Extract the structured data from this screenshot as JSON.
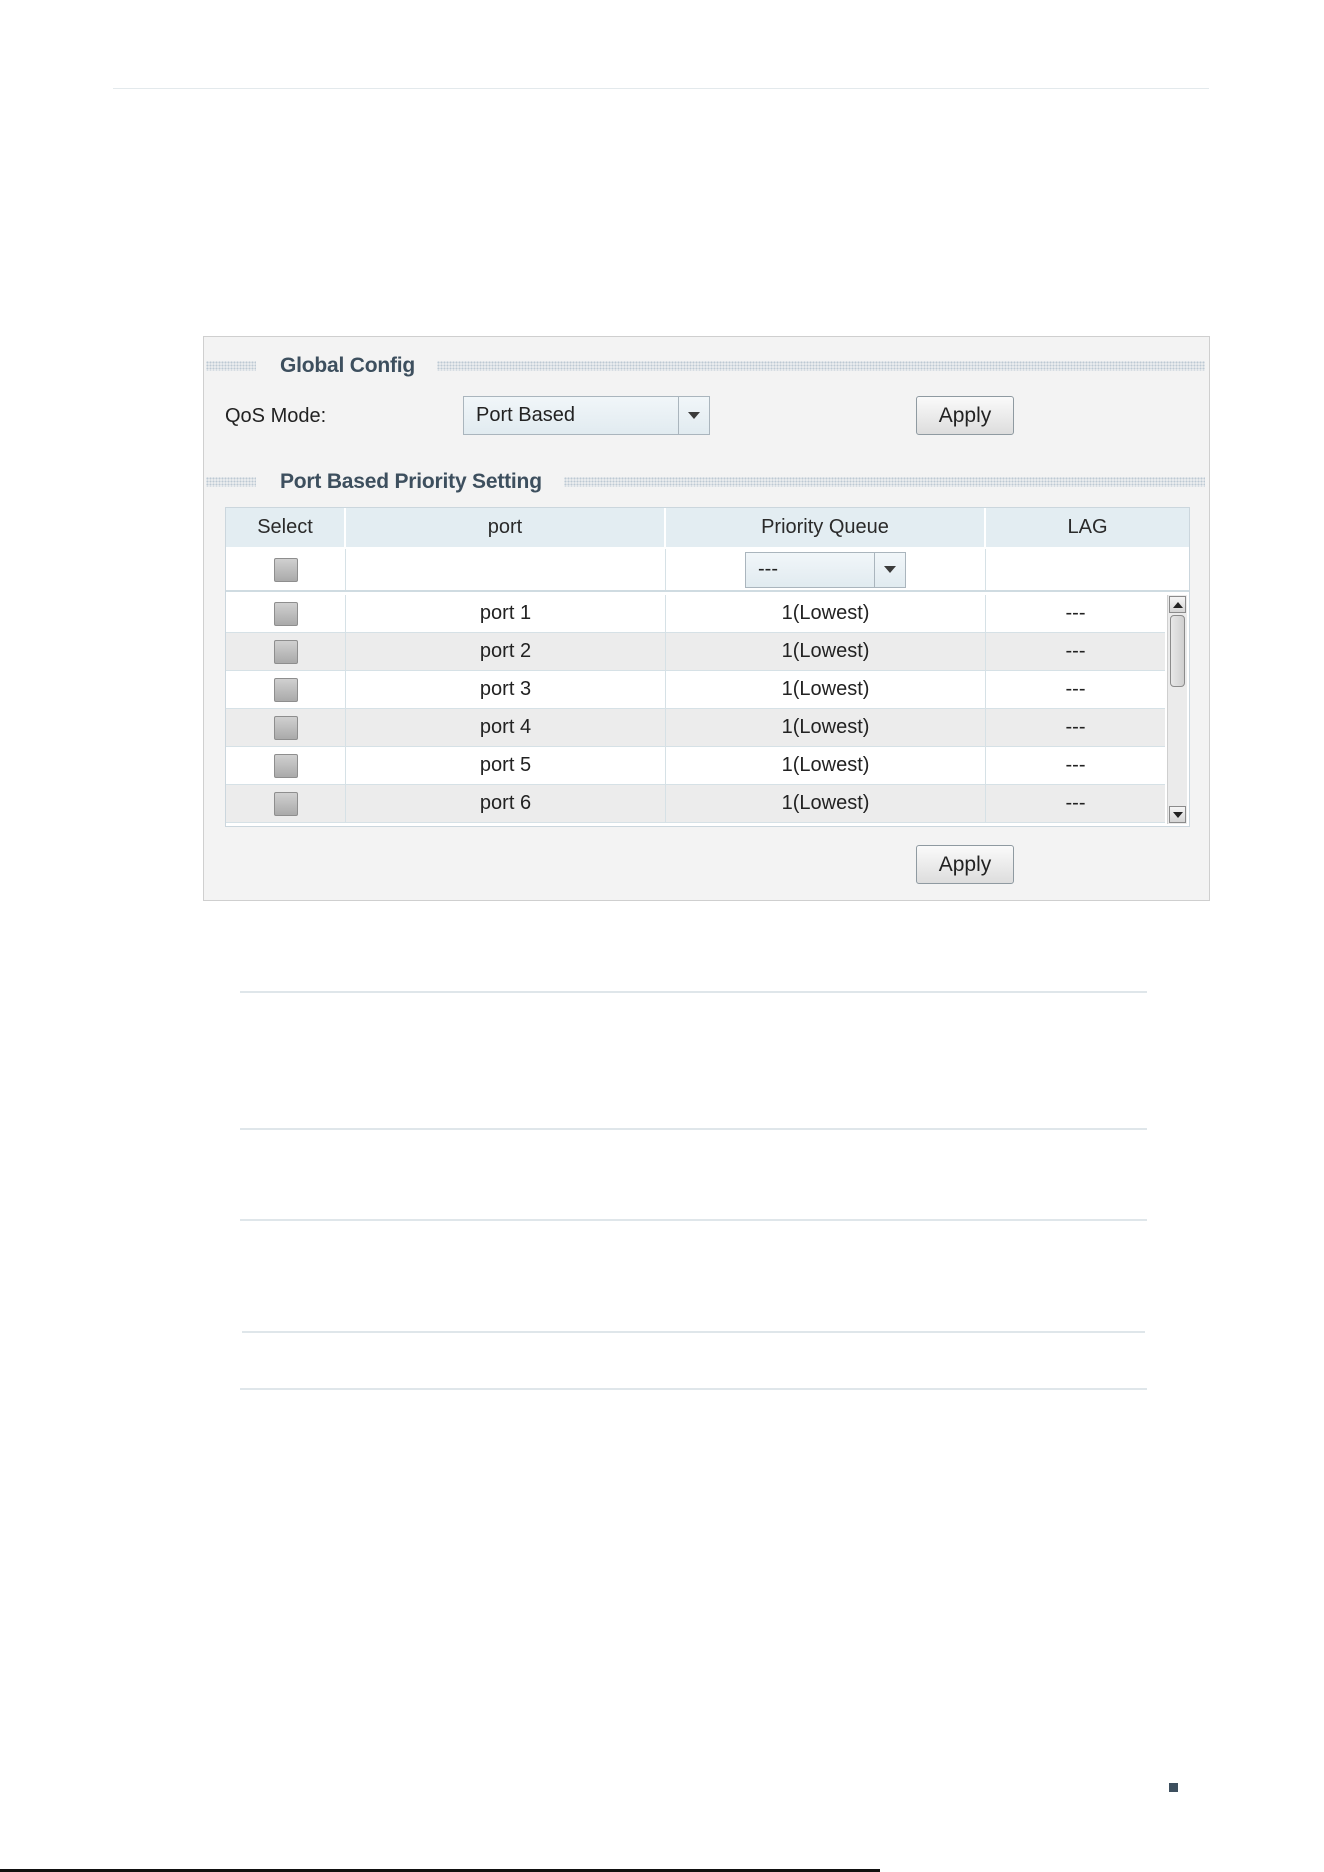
{
  "global_config": {
    "section_title": "Global Config",
    "qos_mode_label": "QoS Mode:",
    "qos_mode_value": "Port Based",
    "apply_label": "Apply"
  },
  "port_priority": {
    "section_title": "Port Based Priority Setting",
    "columns": [
      "Select",
      "port",
      "Priority Queue",
      "LAG"
    ],
    "filter_priority_value": "---",
    "rows": [
      {
        "port": "port 1",
        "priority_queue": "1(Lowest)",
        "lag": "---"
      },
      {
        "port": "port 2",
        "priority_queue": "1(Lowest)",
        "lag": "---"
      },
      {
        "port": "port 3",
        "priority_queue": "1(Lowest)",
        "lag": "---"
      },
      {
        "port": "port 4",
        "priority_queue": "1(Lowest)",
        "lag": "---"
      },
      {
        "port": "port 5",
        "priority_queue": "1(Lowest)",
        "lag": "---"
      },
      {
        "port": "port 6",
        "priority_queue": "1(Lowest)",
        "lag": "---"
      }
    ],
    "apply_label": "Apply"
  },
  "footer": {
    "bottom_text": ""
  }
}
